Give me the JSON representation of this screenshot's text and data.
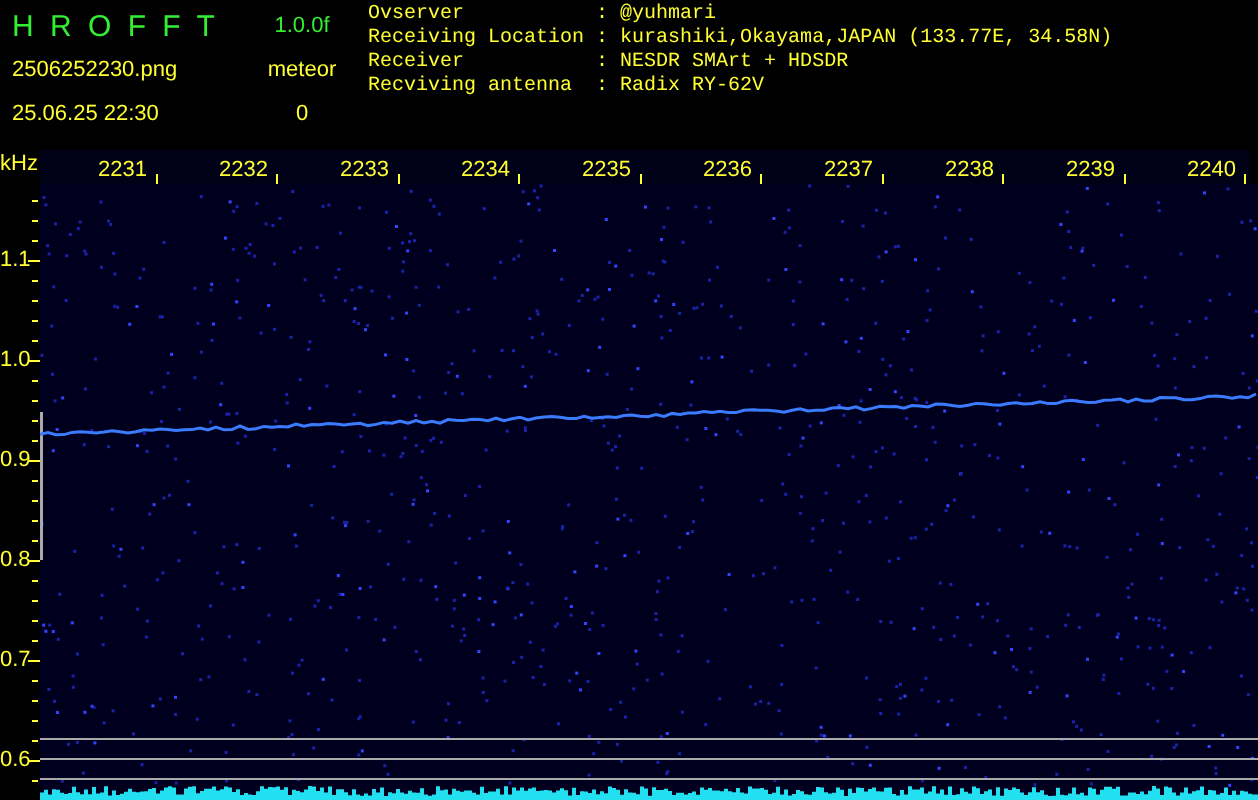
{
  "header": {
    "title": "H R O F F T",
    "version": "1.0.0f",
    "filename": "2506252230.png",
    "datetime": "25.06.25 22:30",
    "meteor_label": "meteor",
    "meteor_count": "0"
  },
  "info": [
    {
      "label": "Ovserver",
      "separator": ":",
      "value": "@yuhmari"
    },
    {
      "label": "Receiving Location",
      "separator": ":",
      "value": "kurashiki,Okayama,JAPAN (133.77E, 34.58N)"
    },
    {
      "label": "Receiver",
      "separator": ":",
      "value": "NESDR SMArt + HDSDR"
    },
    {
      "label": "Recviving antenna",
      "separator": ":",
      "value": "Radix RY-62V"
    }
  ],
  "x_axis": {
    "unit": "kHz",
    "labels": [
      "2231",
      "2232",
      "2233",
      "2234",
      "2235",
      "2236",
      "2237",
      "2238",
      "2239",
      "2240"
    ]
  },
  "y_axis": {
    "labels": [
      "1.1",
      "1.0",
      "0.9",
      "0.8",
      "0.7",
      "0.6"
    ]
  }
}
